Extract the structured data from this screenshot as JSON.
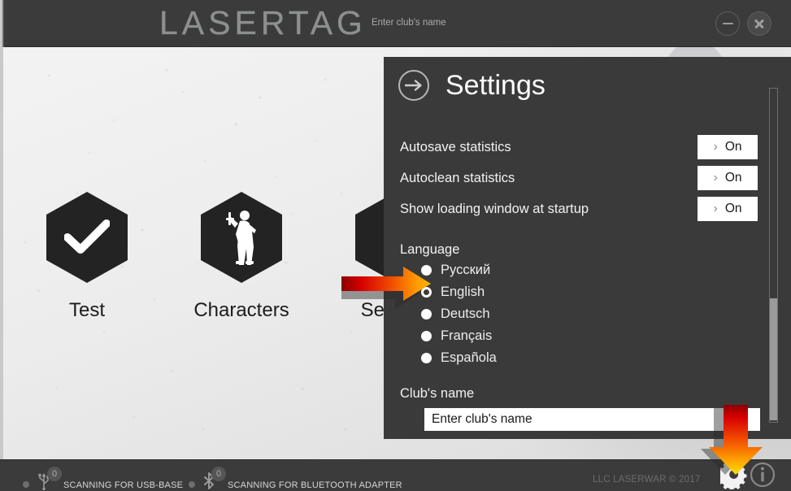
{
  "titlebar": {
    "logo": "LASERTAG",
    "club_name_hint": "Enter club's name",
    "minimize_label": "–",
    "close_label": "×"
  },
  "menu": {
    "items": [
      {
        "label": "Test",
        "icon": "check-icon"
      },
      {
        "label": "Characters",
        "icon": "soldier-icon"
      },
      {
        "label": "Settings",
        "icon": "dots-icon"
      }
    ]
  },
  "settings": {
    "title": "Settings",
    "back_icon": "arrow-right-circle-icon",
    "toggles": [
      {
        "label": "Autosave statistics",
        "value": "On",
        "chevron": "›"
      },
      {
        "label": "Autoclean statistics",
        "value": "On",
        "chevron": "›"
      },
      {
        "label": "Show loading window at startup",
        "value": "On",
        "chevron": "›"
      }
    ],
    "language_label": "Language",
    "languages": [
      {
        "label": "Русский",
        "selected": false
      },
      {
        "label": "English",
        "selected": true
      },
      {
        "label": "Deutsch",
        "selected": false
      },
      {
        "label": "Français",
        "selected": false
      },
      {
        "label": "Española",
        "selected": false
      }
    ],
    "club_label": "Club's name",
    "club_placeholder": "Enter club's name",
    "club_value": ""
  },
  "statusbar": {
    "usb": {
      "text": "SCANNING FOR USB-BASE",
      "count": "0",
      "icon": "usb-icon"
    },
    "bluetooth": {
      "text": "SCANNING FOR BLUETOOTH ADAPTER",
      "count": "0",
      "icon": "bluetooth-icon"
    },
    "copyright": "LLC LASERWAR © 2017",
    "gear_icon": "gear-icon",
    "info_icon": "info-icon"
  },
  "annotations": {
    "arrow_right": "red-orange-arrow-pointing-to-english-radio",
    "arrow_down": "red-yellow-arrow-pointing-to-gear-button"
  },
  "colors": {
    "panel_bg": "#3a3a3a",
    "titlebar_bg": "#3b3b3b",
    "accent_arrow_start": "#c40000",
    "accent_arrow_end": "#ffc400",
    "hex_fill": "#232323",
    "toggle_bg": "#ffffff"
  }
}
